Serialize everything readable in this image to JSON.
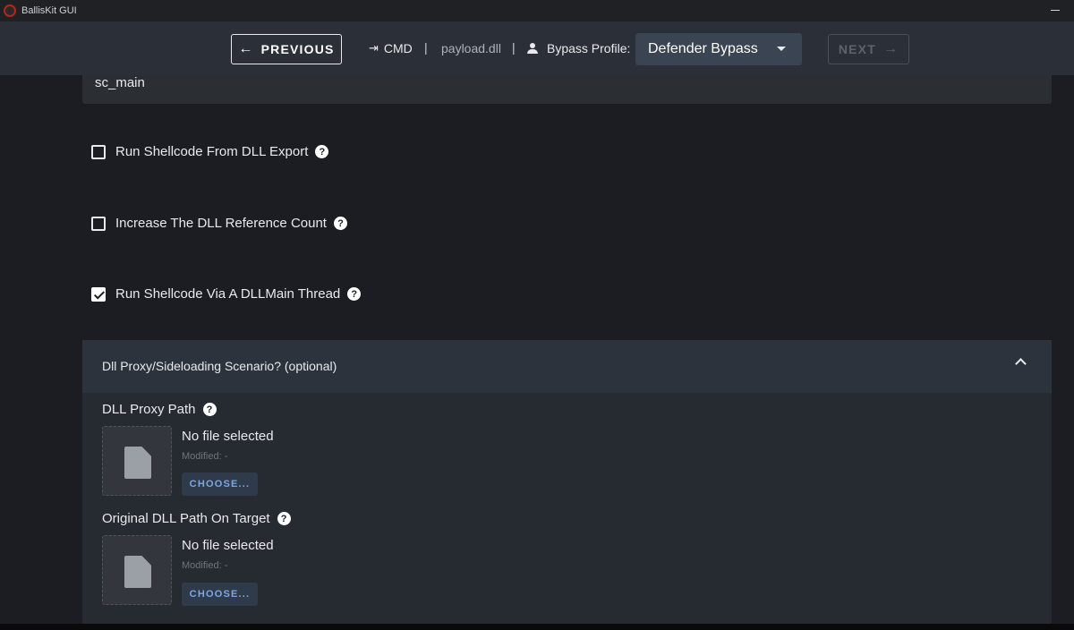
{
  "window": {
    "title": "BallisKit GUI"
  },
  "toolbar": {
    "previous_label": "PREVIOUS",
    "previous_arrow": "←",
    "cmd_label": "CMD",
    "separator": "|",
    "payload_name": "payload.dll",
    "bypass_label": "Bypass Profile:",
    "bypass_value": "Defender Bypass",
    "next_label": "NEXT",
    "next_arrow": "→"
  },
  "export_field": {
    "value": "sc_main"
  },
  "options": [
    {
      "label": "Run Shellcode From DLL Export",
      "checked": false
    },
    {
      "label": "Increase The DLL Reference Count",
      "checked": false
    },
    {
      "label": "Run Shellcode Via A DLLMain Thread",
      "checked": true
    }
  ],
  "help_glyph": "?",
  "panel": {
    "title": "Dll Proxy/Sideloading Scenario? (optional)",
    "files": [
      {
        "label": "DLL Proxy Path",
        "name": "No file selected",
        "modified": "Modified: -",
        "button": "CHOOSE..."
      },
      {
        "label": "Original DLL Path On Target",
        "name": "No file selected",
        "modified": "Modified: -",
        "button": "CHOOSE..."
      }
    ]
  },
  "colors": {
    "background": "#1b1d22",
    "topbar": "#2b3038",
    "accent": "#7ba7e6",
    "select": "#3a4453"
  }
}
